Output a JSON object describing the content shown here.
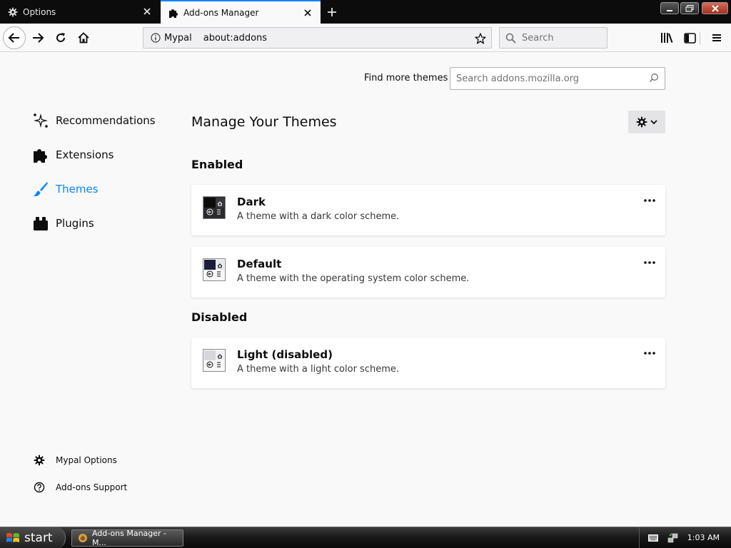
{
  "tabs": [
    {
      "label": "Options",
      "icon": "gear-icon",
      "active": false
    },
    {
      "label": "Add-ons Manager",
      "icon": "puzzle-icon",
      "active": true
    }
  ],
  "urlbar": {
    "identity": "Mypal",
    "url": "about:addons"
  },
  "searchbar": {
    "placeholder": "Search"
  },
  "find_more": {
    "label": "Find more themes",
    "search_placeholder": "Search addons.mozilla.org"
  },
  "categories": [
    {
      "label": "Recommendations",
      "icon": "sparkle-icon",
      "selected": false
    },
    {
      "label": "Extensions",
      "icon": "puzzle-icon",
      "selected": false
    },
    {
      "label": "Themes",
      "icon": "brush-icon",
      "selected": true
    },
    {
      "label": "Plugins",
      "icon": "plugin-block-icon",
      "selected": false
    }
  ],
  "footer_links": [
    {
      "label": "Mypal Options",
      "icon": "gear-icon"
    },
    {
      "label": "Add-ons Support",
      "icon": "help-circle-icon"
    }
  ],
  "main": {
    "heading": "Manage Your Themes",
    "enabled_heading": "Enabled",
    "disabled_heading": "Disabled",
    "themes": [
      {
        "name": "Dark",
        "description": "A theme with a dark color scheme.",
        "status": "enabled"
      },
      {
        "name": "Default",
        "description": "A theme with the operating system color scheme.",
        "status": "enabled"
      },
      {
        "name": "Light (disabled)",
        "description": "A theme with a light color scheme.",
        "status": "disabled"
      }
    ]
  },
  "taskbar": {
    "start_label": "start",
    "task_label": "Add-ons Manager - M...",
    "clock": "1:03 AM"
  },
  "colors": {
    "accent": "#0a84ff",
    "tab_strip": "#0c0c0d",
    "page_bg": "#f9f9fa"
  }
}
